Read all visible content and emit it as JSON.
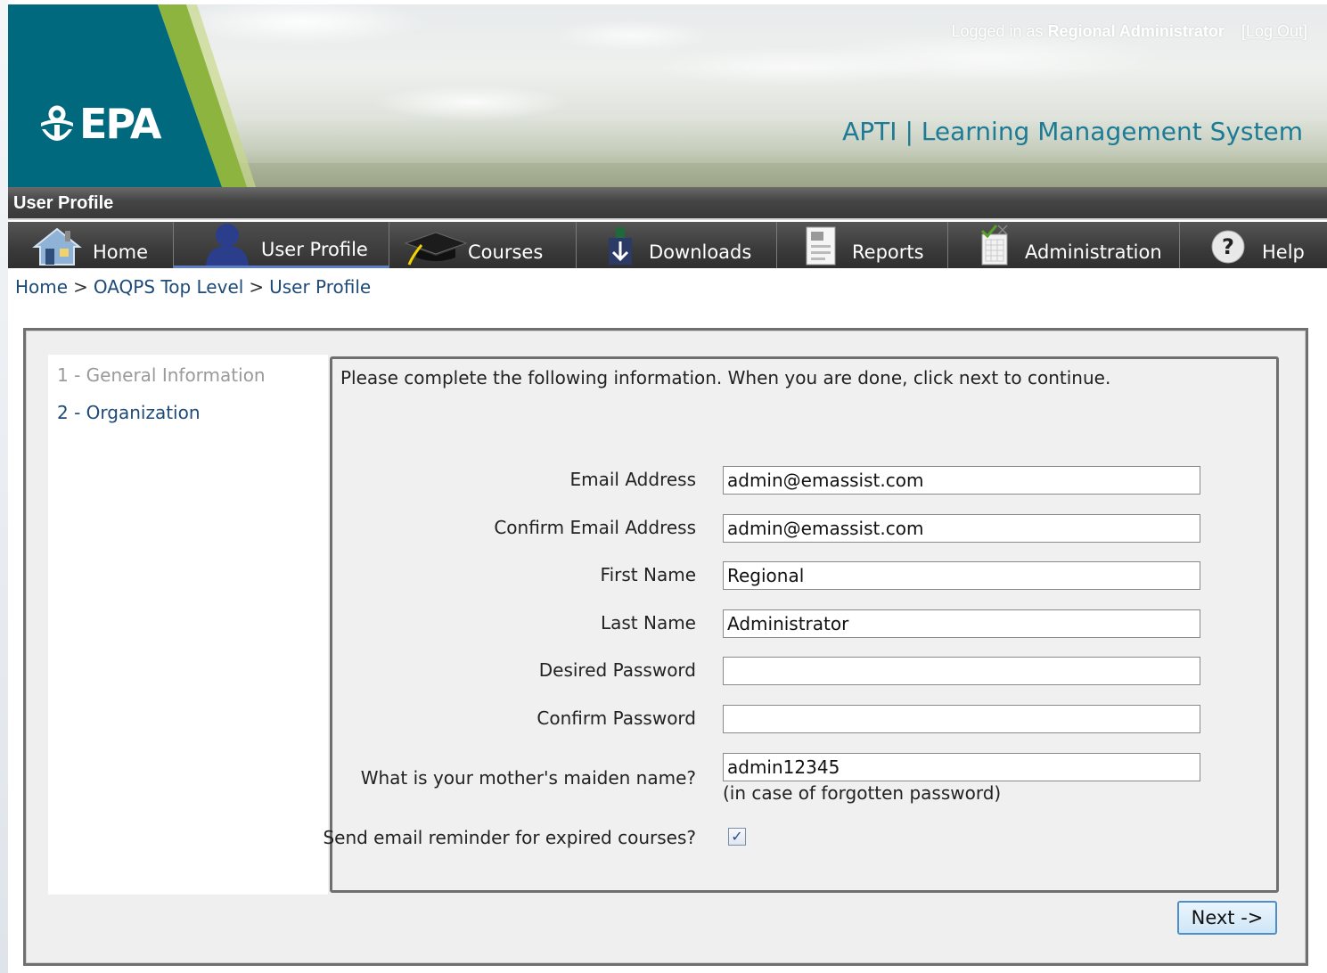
{
  "header": {
    "logo_text": "EPA",
    "logged_in_prefix": "Logged in as",
    "logged_in_user": "Regional Administrator",
    "logout_label": "[Log Out]",
    "app_title": "APTI | Learning Management System"
  },
  "page_title": "User Profile",
  "nav": {
    "items": [
      {
        "label": "Home",
        "icon": "home-icon"
      },
      {
        "label": "User Profile",
        "icon": "user-icon",
        "active": true
      },
      {
        "label": "Courses",
        "icon": "graduation-cap-icon"
      },
      {
        "label": "Downloads",
        "icon": "download-icon"
      },
      {
        "label": "Reports",
        "icon": "report-icon"
      },
      {
        "label": "Administration",
        "icon": "clipboard-check-icon"
      },
      {
        "label": "Help",
        "icon": "help-icon"
      }
    ]
  },
  "breadcrumb": {
    "items": [
      "Home",
      "OAQPS Top Level",
      "User Profile"
    ],
    "separator": ">"
  },
  "steps": [
    {
      "label": "1 - General Information",
      "state": "disabled"
    },
    {
      "label": "2 - Organization",
      "state": "link"
    }
  ],
  "form": {
    "intro": "Please complete the following information. When you are done, click next to continue.",
    "fields": {
      "email": {
        "label": "Email Address",
        "value": "admin@emassist.com"
      },
      "confirm_email": {
        "label": "Confirm Email Address",
        "value": "admin@emassist.com"
      },
      "first_name": {
        "label": "First Name",
        "value": "Regional"
      },
      "last_name": {
        "label": "Last Name",
        "value": "Administrator"
      },
      "password": {
        "label": "Desired Password",
        "value": ""
      },
      "confirm_password": {
        "label": "Confirm Password",
        "value": ""
      },
      "maiden_name": {
        "label": "What is your mother's maiden name?",
        "value": "admin12345",
        "hint": "(in case of forgotten password)"
      },
      "reminder": {
        "label": "Send email reminder for expired courses?",
        "checked": true,
        "check_glyph": "✓"
      }
    },
    "next_label": "Next ->"
  },
  "colors": {
    "teal": "#00697d",
    "green_stripe": "#8cb43f",
    "title_blue": "#1d7b95",
    "link_blue": "#1e4a78",
    "nav_dark": "#3a3a3a"
  }
}
